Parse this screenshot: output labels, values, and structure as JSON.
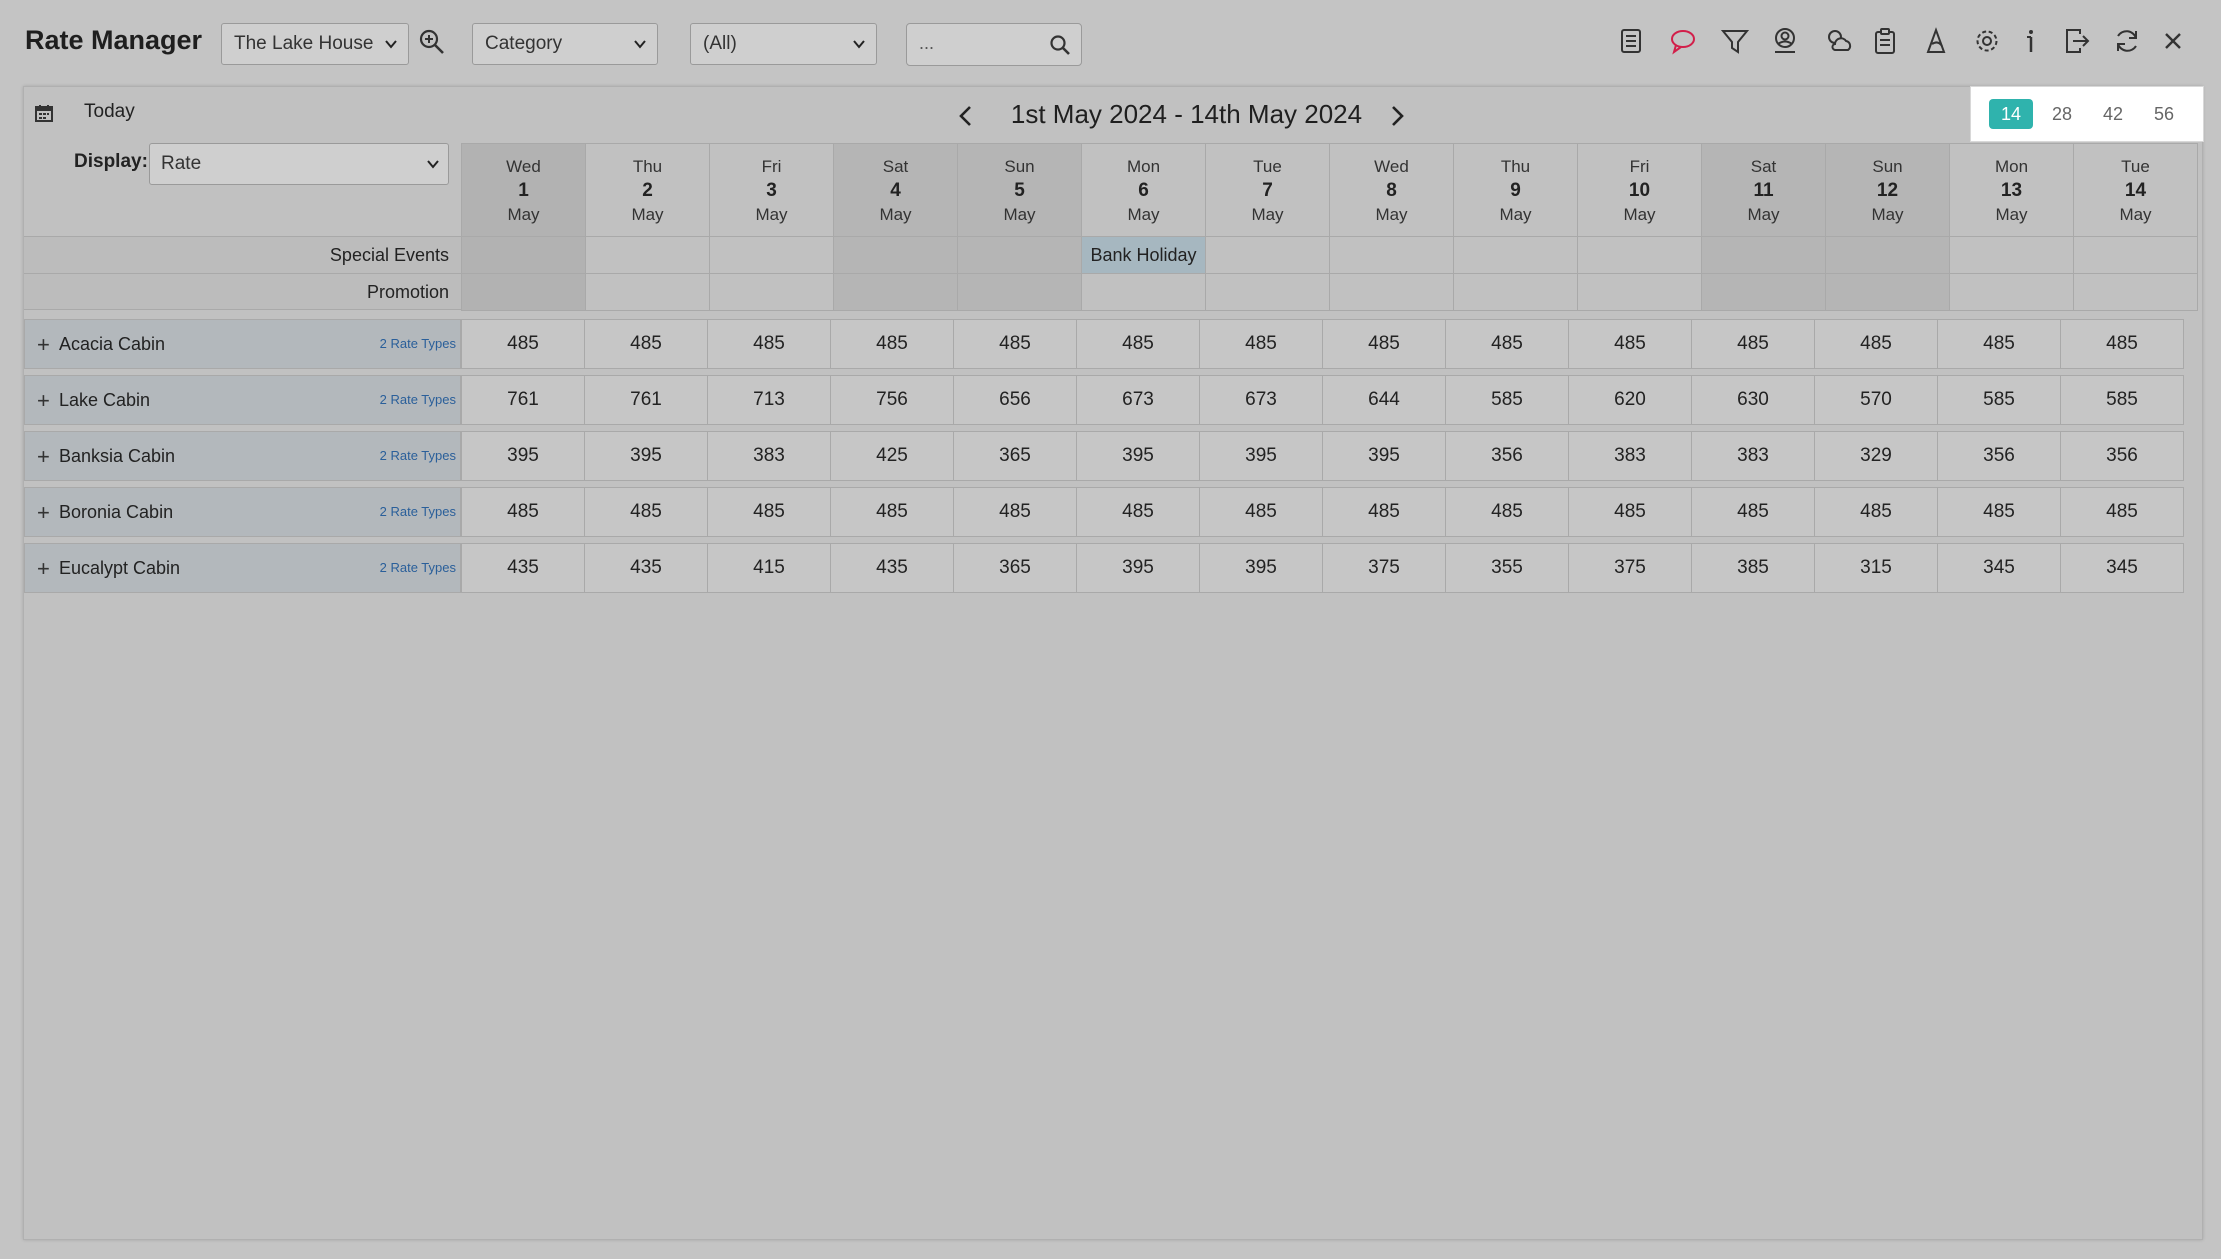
{
  "app": {
    "title": "Rate Manager"
  },
  "toolbar": {
    "property": "The Lake House",
    "group_by": "Category",
    "filter": "(All)",
    "search_placeholder": "...",
    "icons": [
      "report-icon",
      "comment-icon",
      "filter-icon",
      "guest-icon",
      "weather-icon",
      "clipboard-icon",
      "wizard-icon",
      "settings-icon",
      "info-icon",
      "export-icon",
      "refresh-icon",
      "close-icon"
    ]
  },
  "nav": {
    "today": "Today",
    "range": "1st May 2024 - 14th May 2024",
    "day_options": [
      "14",
      "28",
      "42",
      "56"
    ],
    "active_option": "14"
  },
  "display": {
    "label": "Display:",
    "value": "Rate"
  },
  "days": [
    {
      "dow": "Wed",
      "num": "1",
      "mon": "May"
    },
    {
      "dow": "Thu",
      "num": "2",
      "mon": "May"
    },
    {
      "dow": "Fri",
      "num": "3",
      "mon": "May"
    },
    {
      "dow": "Sat",
      "num": "4",
      "mon": "May"
    },
    {
      "dow": "Sun",
      "num": "5",
      "mon": "May"
    },
    {
      "dow": "Mon",
      "num": "6",
      "mon": "May"
    },
    {
      "dow": "Tue",
      "num": "7",
      "mon": "May"
    },
    {
      "dow": "Wed",
      "num": "8",
      "mon": "May"
    },
    {
      "dow": "Thu",
      "num": "9",
      "mon": "May"
    },
    {
      "dow": "Fri",
      "num": "10",
      "mon": "May"
    },
    {
      "dow": "Sat",
      "num": "11",
      "mon": "May"
    },
    {
      "dow": "Sun",
      "num": "12",
      "mon": "May"
    },
    {
      "dow": "Mon",
      "num": "13",
      "mon": "May"
    },
    {
      "dow": "Tue",
      "num": "14",
      "mon": "May"
    }
  ],
  "event_rows": {
    "special_events_label": "Special Events",
    "promotion_label": "Promotion",
    "special_events": [
      "",
      "",
      "",
      "",
      "",
      "Bank Holiday",
      "",
      "",
      "",
      "",
      "",
      "",
      "",
      ""
    ]
  },
  "rooms": [
    {
      "name": "Acacia Cabin",
      "rate_types": "2 Rate Types",
      "rates": [
        "485",
        "485",
        "485",
        "485",
        "485",
        "485",
        "485",
        "485",
        "485",
        "485",
        "485",
        "485",
        "485",
        "485"
      ]
    },
    {
      "name": "Lake Cabin",
      "rate_types": "2 Rate Types",
      "rates": [
        "761",
        "761",
        "713",
        "756",
        "656",
        "673",
        "673",
        "644",
        "585",
        "620",
        "630",
        "570",
        "585",
        "585"
      ]
    },
    {
      "name": "Banksia Cabin",
      "rate_types": "2 Rate Types",
      "rates": [
        "395",
        "395",
        "383",
        "425",
        "365",
        "395",
        "395",
        "395",
        "356",
        "383",
        "383",
        "329",
        "356",
        "356"
      ]
    },
    {
      "name": "Boronia Cabin",
      "rate_types": "2 Rate Types",
      "rates": [
        "485",
        "485",
        "485",
        "485",
        "485",
        "485",
        "485",
        "485",
        "485",
        "485",
        "485",
        "485",
        "485",
        "485"
      ]
    },
    {
      "name": "Eucalypt Cabin",
      "rate_types": "2 Rate Types",
      "rates": [
        "435",
        "435",
        "415",
        "435",
        "365",
        "395",
        "395",
        "375",
        "355",
        "375",
        "385",
        "315",
        "345",
        "345"
      ]
    }
  ]
}
